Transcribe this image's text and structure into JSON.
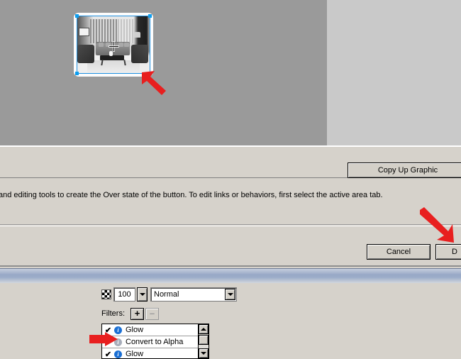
{
  "app": {
    "accent_blue": "#0d9ef0",
    "panel_bg": "#d6d2cb",
    "canvas_bg": "#9a9a9a",
    "canvas_pad_bg": "#c9c9c9",
    "annotation_color": "#e81f1f"
  },
  "canvas": {
    "graphic_name": "selected-button-graphic",
    "cursor": "crosshair"
  },
  "dialog": {
    "copy_up_graphic_label": "Copy Up Graphic",
    "description": "and editing tools to create the Over state of the button. To edit links or behaviors, first select the active area tab.",
    "cancel_label": "Cancel",
    "done_label": "D"
  },
  "layers_panel": {
    "opacity_value": "100",
    "blend_mode": "Normal",
    "filters_label": "Filters:",
    "add_filter_label": "+",
    "remove_filter_label": "–",
    "filters": [
      {
        "checked": "✔",
        "icon": "info-icon",
        "icon_dim": false,
        "label": "Glow"
      },
      {
        "checked": "✔",
        "icon": "info-icon",
        "icon_dim": true,
        "label": "Convert to Alpha"
      },
      {
        "checked": "✔",
        "icon": "info-icon",
        "icon_dim": false,
        "label": "Glow"
      }
    ]
  }
}
